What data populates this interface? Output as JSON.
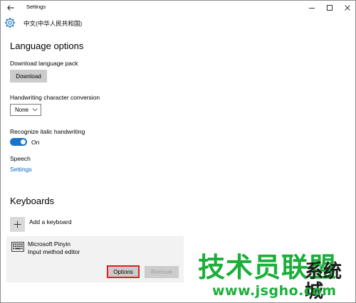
{
  "window": {
    "title": "Settings"
  },
  "header": {
    "title": "中文(中华人民共和国)"
  },
  "language_options": {
    "heading": "Language options",
    "download_pack_label": "Download language pack",
    "download_button": "Download",
    "handwriting_label": "Handwriting character conversion",
    "handwriting_value": "None",
    "italic_label": "Recognize italic handwriting",
    "italic_toggle_state": "On",
    "speech_label": "Speech",
    "speech_link": "Settings"
  },
  "keyboards": {
    "heading": "Keyboards",
    "add_label": "Add a keyboard",
    "items": [
      {
        "name": "Microsoft Pinyin",
        "subtitle": "Input method editor",
        "options_button": "Options",
        "remove_button": "Remove"
      }
    ]
  },
  "watermark": {
    "text_cn_green": "技术员联盟",
    "text_cn_dark": "系统城",
    "url": "www.jsgho.com"
  },
  "colors": {
    "accent": "#1a73c9",
    "link": "#0a67c2",
    "button_gray": "#cccccc",
    "highlight_red": "#e02020",
    "watermark_green": "#1cae3a"
  },
  "icons": {
    "back": "back-arrow-icon",
    "minimize": "minimize-icon",
    "maximize": "maximize-icon",
    "close": "close-icon",
    "settings": "gear-icon",
    "dropdown": "chevron-down-icon",
    "add": "plus-icon",
    "keyboard": "keyboard-icon"
  }
}
